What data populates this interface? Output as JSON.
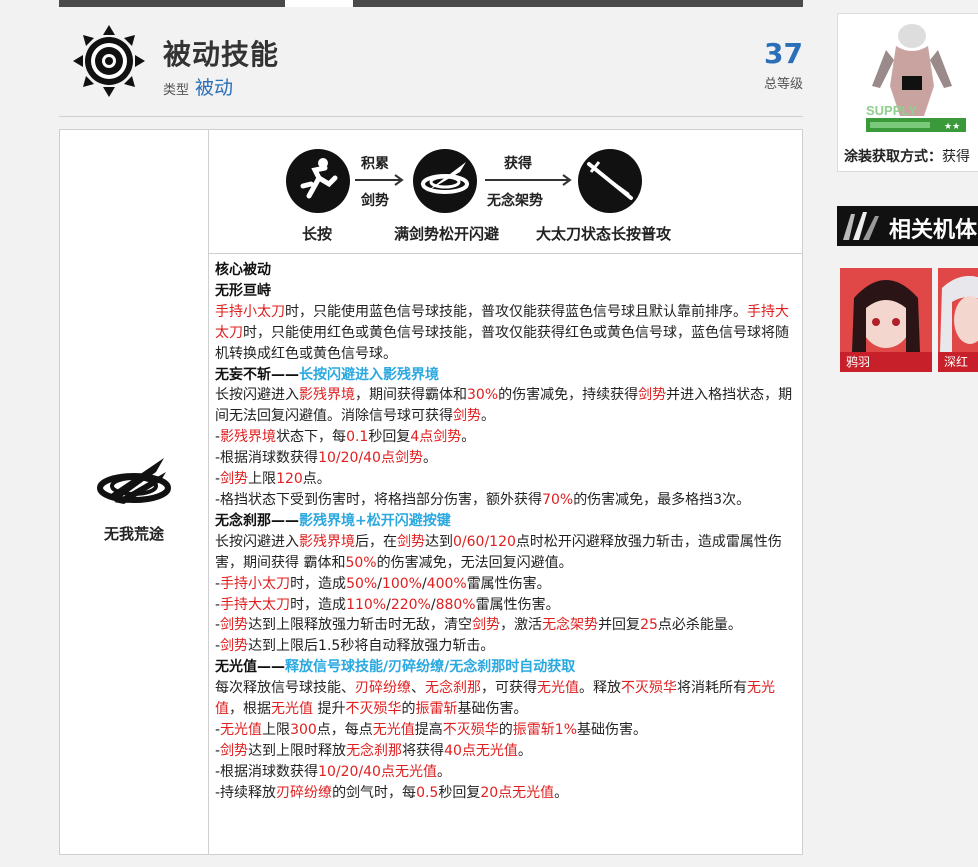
{
  "header": {
    "title": "被动技能",
    "type_label": "类型",
    "type_value": "被动",
    "level_value": "37",
    "level_label": "总等级",
    "icon": "gear-sun-icon"
  },
  "skill": {
    "name": "无我荒途",
    "icon": "slash-swirl-icon"
  },
  "flow": {
    "step1_label": "长按",
    "arrow1_top": "积累",
    "arrow1_bottom": "剑势",
    "step2_label": "满剑势松开闪避",
    "arrow2_top": "获得",
    "arrow2_bottom": "无念架势",
    "step3_label": "大太刀状态长按普攻"
  },
  "desc": [
    [
      {
        "t": "核心被动",
        "c": "h"
      }
    ],
    [
      {
        "t": "无形亘峙",
        "c": "h"
      }
    ],
    [
      {
        "t": "手持小太刀",
        "c": "r"
      },
      {
        "t": "时，只能使用蓝色信号球技能，普攻仅能获得蓝色信号球且默认靠前排序。"
      },
      {
        "t": "手持大太刀",
        "c": "r"
      },
      {
        "t": "时，只能使用红色或黄色信号球技能，普攻仅能获得红色或黄色信号球，蓝色信号球将随机转换成红色或黄色信号球。"
      }
    ],
    [
      {
        "t": "无妄不斩——",
        "c": "h"
      },
      {
        "t": "长按闪避进入影残界境",
        "c": "b"
      }
    ],
    [
      {
        "t": "长按闪避进入"
      },
      {
        "t": "影残界境",
        "c": "r"
      },
      {
        "t": "，期间获得霸体和"
      },
      {
        "t": "30%",
        "c": "r"
      },
      {
        "t": "的伤害减免，持续获得"
      },
      {
        "t": "剑势",
        "c": "r"
      },
      {
        "t": "并进入格挡状态，期间无法回复闪避值。消除信号球可获得"
      },
      {
        "t": "剑势",
        "c": "r"
      },
      {
        "t": "。"
      }
    ],
    [
      {
        "t": "-"
      },
      {
        "t": "影残界境",
        "c": "r"
      },
      {
        "t": "状态下，每"
      },
      {
        "t": "0.1",
        "c": "r"
      },
      {
        "t": "秒回复"
      },
      {
        "t": "4点剑势",
        "c": "r"
      },
      {
        "t": "。"
      }
    ],
    [
      {
        "t": "-根据消球数获得"
      },
      {
        "t": "10/20/40点剑势",
        "c": "r"
      },
      {
        "t": "。"
      }
    ],
    [
      {
        "t": "-"
      },
      {
        "t": "剑势",
        "c": "r"
      },
      {
        "t": "上限"
      },
      {
        "t": "120",
        "c": "r"
      },
      {
        "t": "点。"
      }
    ],
    [
      {
        "t": "-格挡状态下受到伤害时，将格挡部分伤害，额外获得"
      },
      {
        "t": "70%",
        "c": "r"
      },
      {
        "t": "的伤害减免，最多格挡3次。"
      }
    ],
    [
      {
        "t": "无念刹那——",
        "c": "h"
      },
      {
        "t": "影残界境+松开闪避按键",
        "c": "b"
      }
    ],
    [
      {
        "t": "长按闪避进入"
      },
      {
        "t": "影残界境",
        "c": "r"
      },
      {
        "t": "后，在"
      },
      {
        "t": "剑势",
        "c": "r"
      },
      {
        "t": "达到"
      },
      {
        "t": "0/60/120",
        "c": "r"
      },
      {
        "t": "点时松开闪避释放强力斩击，造成雷属性伤害，期间获得 霸体和"
      },
      {
        "t": "50%",
        "c": "r"
      },
      {
        "t": "的伤害减免，无法回复闪避值。"
      }
    ],
    [
      {
        "t": "-"
      },
      {
        "t": "手持小太刀",
        "c": "r"
      },
      {
        "t": "时，造成"
      },
      {
        "t": "50%",
        "c": "r"
      },
      {
        "t": "/"
      },
      {
        "t": "100%",
        "c": "r"
      },
      {
        "t": "/"
      },
      {
        "t": "400%",
        "c": "r"
      },
      {
        "t": "雷属性伤害。"
      }
    ],
    [
      {
        "t": "-"
      },
      {
        "t": "手持大太刀",
        "c": "r"
      },
      {
        "t": "时，造成"
      },
      {
        "t": "110%",
        "c": "r"
      },
      {
        "t": "/"
      },
      {
        "t": "220%",
        "c": "r"
      },
      {
        "t": "/"
      },
      {
        "t": "880%",
        "c": "r"
      },
      {
        "t": "雷属性伤害。"
      }
    ],
    [
      {
        "t": "-"
      },
      {
        "t": "剑势",
        "c": "r"
      },
      {
        "t": "达到上限释放强力斩击时无敌，清空"
      },
      {
        "t": "剑势",
        "c": "r"
      },
      {
        "t": "，激活"
      },
      {
        "t": "无念架势",
        "c": "r"
      },
      {
        "t": "并回复"
      },
      {
        "t": "25",
        "c": "r"
      },
      {
        "t": "点必杀能量。"
      }
    ],
    [
      {
        "t": "-"
      },
      {
        "t": "剑势",
        "c": "r"
      },
      {
        "t": "达到上限后1.5秒将自动释放强力斩击。"
      }
    ],
    [
      {
        "t": "无光值——",
        "c": "h"
      },
      {
        "t": "释放信号球技能/刃碎纷缭/无念刹那时自动获取",
        "c": "b"
      }
    ],
    [
      {
        "t": "每次释放信号球技能、"
      },
      {
        "t": "刃碎纷缭",
        "c": "r"
      },
      {
        "t": "、"
      },
      {
        "t": "无念刹那",
        "c": "r"
      },
      {
        "t": "，可获得"
      },
      {
        "t": "无光值",
        "c": "r"
      },
      {
        "t": "。释放"
      },
      {
        "t": "不灭殒华",
        "c": "r"
      },
      {
        "t": "将消耗所有"
      },
      {
        "t": "无光值",
        "c": "r"
      },
      {
        "t": "，根据"
      },
      {
        "t": "无光值",
        "c": "r"
      },
      {
        "t": " 提升"
      },
      {
        "t": "不灭殒华",
        "c": "r"
      },
      {
        "t": "的"
      },
      {
        "t": "振雷斩",
        "c": "r"
      },
      {
        "t": "基础伤害。"
      }
    ],
    [
      {
        "t": "-"
      },
      {
        "t": "无光值",
        "c": "r"
      },
      {
        "t": "上限"
      },
      {
        "t": "300",
        "c": "r"
      },
      {
        "t": "点，每点"
      },
      {
        "t": "无光值",
        "c": "r"
      },
      {
        "t": "提高"
      },
      {
        "t": "不灭殒华",
        "c": "r"
      },
      {
        "t": "的"
      },
      {
        "t": "振雷斩1%",
        "c": "r"
      },
      {
        "t": "基础伤害。"
      }
    ],
    [
      {
        "t": "-"
      },
      {
        "t": "剑势",
        "c": "r"
      },
      {
        "t": "达到上限时释放"
      },
      {
        "t": "无念刹那",
        "c": "r"
      },
      {
        "t": "将获得"
      },
      {
        "t": "40点无光值",
        "c": "r"
      },
      {
        "t": "。"
      }
    ],
    [
      {
        "t": "-根据消球数获得"
      },
      {
        "t": "10/20/40点无光值",
        "c": "r"
      },
      {
        "t": "。"
      }
    ],
    [
      {
        "t": "-持续释放"
      },
      {
        "t": "刃碎纷缭",
        "c": "r"
      },
      {
        "t": "的剑气时，每"
      },
      {
        "t": "0.5",
        "c": "r"
      },
      {
        "t": "秒回复"
      },
      {
        "t": "20点无光值",
        "c": "r"
      },
      {
        "t": "。"
      }
    ]
  ],
  "sidebar": {
    "supply_text": "SUPPLY",
    "stars": "★★",
    "caption_label": "涂装获取方式：",
    "caption_value": "获得",
    "related_title": "相关机体",
    "related": [
      {
        "name": "鸦羽"
      },
      {
        "name": "深红之"
      }
    ]
  }
}
